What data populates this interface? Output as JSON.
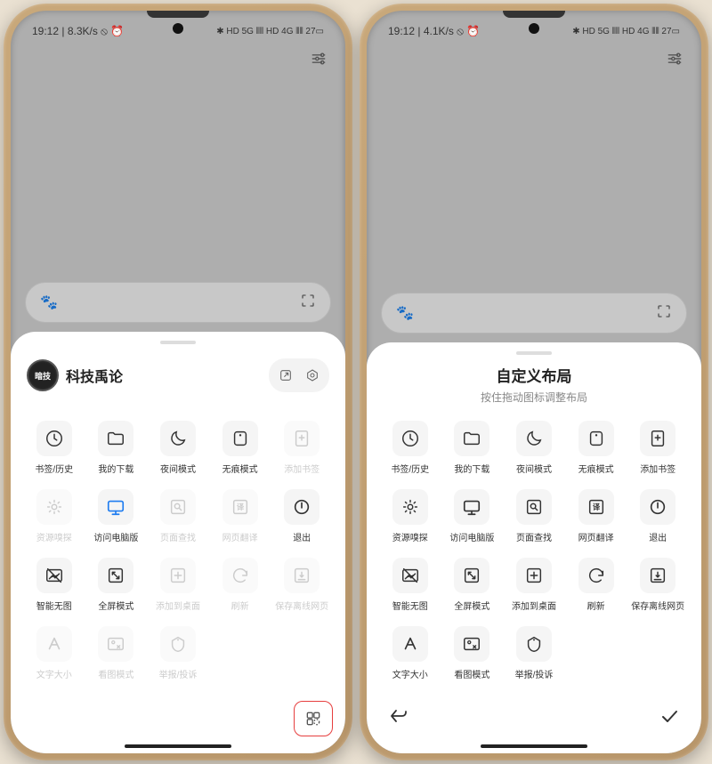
{
  "left": {
    "status": {
      "left": "19:12 | 8.3K/s ⦸ ⏰",
      "right": "✱ HD 5G ⫴⫴ HD 4G ⫴⫴ 27▭"
    },
    "user": {
      "avatar_text": "暗技",
      "name": "科技禹论"
    },
    "menu": [
      {
        "label": "书签/历史",
        "icon": "history",
        "state": ""
      },
      {
        "label": "我的下载",
        "icon": "folder",
        "state": ""
      },
      {
        "label": "夜间模式",
        "icon": "moon",
        "state": ""
      },
      {
        "label": "无痕模式",
        "icon": "incognito",
        "state": ""
      },
      {
        "label": "添加书签",
        "icon": "add-bookmark",
        "state": "disabled"
      },
      {
        "label": "资源嗅探",
        "icon": "sniff",
        "state": "disabled"
      },
      {
        "label": "访问电脑版",
        "icon": "desktop",
        "state": "active"
      },
      {
        "label": "页面查找",
        "icon": "find",
        "state": "disabled"
      },
      {
        "label": "网页翻译",
        "icon": "translate",
        "state": "disabled"
      },
      {
        "label": "退出",
        "icon": "power",
        "state": ""
      },
      {
        "label": "智能无图",
        "icon": "no-image",
        "state": ""
      },
      {
        "label": "全屏模式",
        "icon": "fullscreen",
        "state": ""
      },
      {
        "label": "添加到桌面",
        "icon": "add-home",
        "state": "disabled"
      },
      {
        "label": "刷新",
        "icon": "refresh",
        "state": "disabled"
      },
      {
        "label": "保存离线网页",
        "icon": "save",
        "state": "disabled"
      },
      {
        "label": "文字大小",
        "icon": "font",
        "state": "disabled"
      },
      {
        "label": "看图模式",
        "icon": "gallery",
        "state": "disabled"
      },
      {
        "label": "举报/投诉",
        "icon": "report",
        "state": "disabled"
      }
    ]
  },
  "right": {
    "status": {
      "left": "19:12 | 4.1K/s ⦸ ⏰",
      "right": "✱ HD 5G ⫴⫴ HD 4G ⫴⫴ 27▭"
    },
    "title": "自定义布局",
    "subtitle": "按住拖动图标调整布局",
    "menu": [
      {
        "label": "书签/历史",
        "icon": "history",
        "state": ""
      },
      {
        "label": "我的下载",
        "icon": "folder",
        "state": ""
      },
      {
        "label": "夜间模式",
        "icon": "moon",
        "state": ""
      },
      {
        "label": "无痕模式",
        "icon": "incognito",
        "state": ""
      },
      {
        "label": "添加书签",
        "icon": "add-bookmark",
        "state": ""
      },
      {
        "label": "资源嗅探",
        "icon": "sniff",
        "state": ""
      },
      {
        "label": "访问电脑版",
        "icon": "desktop",
        "state": ""
      },
      {
        "label": "页面查找",
        "icon": "find",
        "state": ""
      },
      {
        "label": "网页翻译",
        "icon": "translate",
        "state": ""
      },
      {
        "label": "退出",
        "icon": "power",
        "state": ""
      },
      {
        "label": "智能无图",
        "icon": "no-image",
        "state": ""
      },
      {
        "label": "全屏模式",
        "icon": "fullscreen",
        "state": ""
      },
      {
        "label": "添加到桌面",
        "icon": "add-home",
        "state": ""
      },
      {
        "label": "刷新",
        "icon": "refresh",
        "state": ""
      },
      {
        "label": "保存离线网页",
        "icon": "save",
        "state": ""
      },
      {
        "label": "文字大小",
        "icon": "font",
        "state": ""
      },
      {
        "label": "看图模式",
        "icon": "gallery",
        "state": ""
      },
      {
        "label": "举报/投诉",
        "icon": "report",
        "state": ""
      }
    ]
  },
  "icons": {
    "history": "<circle cx='12' cy='12' r='9' fill='none' stroke='currentColor' stroke-width='1.6'/><path d='M12 7v5l3 2' fill='none' stroke='currentColor' stroke-width='1.6' stroke-linecap='round'/>",
    "folder": "<path d='M3 7a2 2 0 012-2h4l2 2h8a2 2 0 012 2v8a2 2 0 01-2 2H5a2 2 0 01-2-2z' fill='none' stroke='currentColor' stroke-width='1.6'/>",
    "moon": "<path d='M20 14a8 8 0 01-10-10 8 8 0 1010 10z' fill='none' stroke='currentColor' stroke-width='1.6'/>",
    "incognito": "<rect x='5' y='4' width='14' height='16' rx='3' fill='none' stroke='currentColor' stroke-width='1.6'/><circle cx='12' cy='8' r='1.3' fill='currentColor'/>",
    "add-bookmark": "<rect x='5' y='3' width='14' height='18' rx='2' fill='none' stroke='currentColor' stroke-width='1.6'/><path d='M12 8v6M9 11h6' stroke='currentColor' stroke-width='1.6' stroke-linecap='round'/>",
    "sniff": "<circle cx='12' cy='12' r='3' fill='none' stroke='currentColor' stroke-width='1.6'/><path d='M12 4v2M12 18v2M4 12h2M18 12h2M6 6l1.4 1.4M16.6 16.6L18 18M6 18l1.4-1.4M16.6 7.4L18 6' stroke='currentColor' stroke-width='1.6' stroke-linecap='round'/>",
    "desktop": "<rect x='3' y='5' width='18' height='12' rx='2' fill='none' stroke='currentColor' stroke-width='1.8'/><path d='M8 21h8M12 17v4' stroke='currentColor' stroke-width='1.8' stroke-linecap='round'/>",
    "find": "<rect x='4' y='4' width='16' height='16' rx='2' fill='none' stroke='currentColor' stroke-width='1.6'/><circle cx='11' cy='11' r='3' fill='none' stroke='currentColor' stroke-width='1.6'/><path d='M13.5 13.5L16 16' stroke='currentColor' stroke-width='1.6' stroke-linecap='round'/>",
    "translate": "<rect x='4' y='4' width='16' height='16' rx='2' fill='none' stroke='currentColor' stroke-width='1.6'/><text x='12' y='15' font-size='9' text-anchor='middle' fill='currentColor' font-weight='bold'>译</text>",
    "power": "<circle cx='12' cy='12' r='8' fill='none' stroke='currentColor' stroke-width='1.8'/><path d='M12 7v6' stroke='currentColor' stroke-width='1.8' stroke-linecap='round'/>",
    "no-image": "<rect x='3' y='5' width='18' height='14' rx='2' fill='none' stroke='currentColor' stroke-width='1.6'/><path d='M6 16l4-4 3 3 5-5M4 4l16 16' stroke='currentColor' stroke-width='1.6' stroke-linecap='round'/>",
    "fullscreen": "<rect x='4' y='4' width='16' height='16' rx='2' fill='none' stroke='currentColor' stroke-width='1.6'/><path d='M8 8l8 8M8 8h3M8 8v3M16 16h-3M16 16v-3' stroke='currentColor' stroke-width='1.6' stroke-linecap='round'/>",
    "add-home": "<rect x='4' y='4' width='16' height='16' rx='2' fill='none' stroke='currentColor' stroke-width='1.6'/><path d='M12 8v8M8 12h8' stroke='currentColor' stroke-width='1.6' stroke-linecap='round'/>",
    "refresh": "<path d='M20 12a8 8 0 10-2.3 5.6M20 12V7m0 5h-5' fill='none' stroke='currentColor' stroke-width='1.6' stroke-linecap='round'/>",
    "save": "<rect x='4' y='4' width='16' height='16' rx='2' fill='none' stroke='currentColor' stroke-width='1.6'/><path d='M12 8v6m0 0l-2-2m2 2l2-2M8 17h8' stroke='currentColor' stroke-width='1.6' stroke-linecap='round'/>",
    "font": "<path d='M6 18L12 5l6 13M8.5 13h7' fill='none' stroke='currentColor' stroke-width='1.8' stroke-linecap='round' stroke-linejoin='round'/>",
    "gallery": "<rect x='3' y='5' width='18' height='14' rx='2' fill='none' stroke='currentColor' stroke-width='1.6'/><circle cx='9' cy='10' r='1.7' fill='none' stroke='currentColor' stroke-width='1.4'/><path d='M14 14l3 3m0-3l-3 3' stroke='currentColor' stroke-width='1.5' stroke-linecap='round'/>",
    "report": "<path d='M12 4l7 4v5a8 8 0 01-7 8 8 8 0 01-7-8V8z' fill='none' stroke='currentColor' stroke-width='1.6' stroke-linejoin='round'/><circle cx='12' cy='7' r='1.1' fill='currentColor'/>"
  }
}
